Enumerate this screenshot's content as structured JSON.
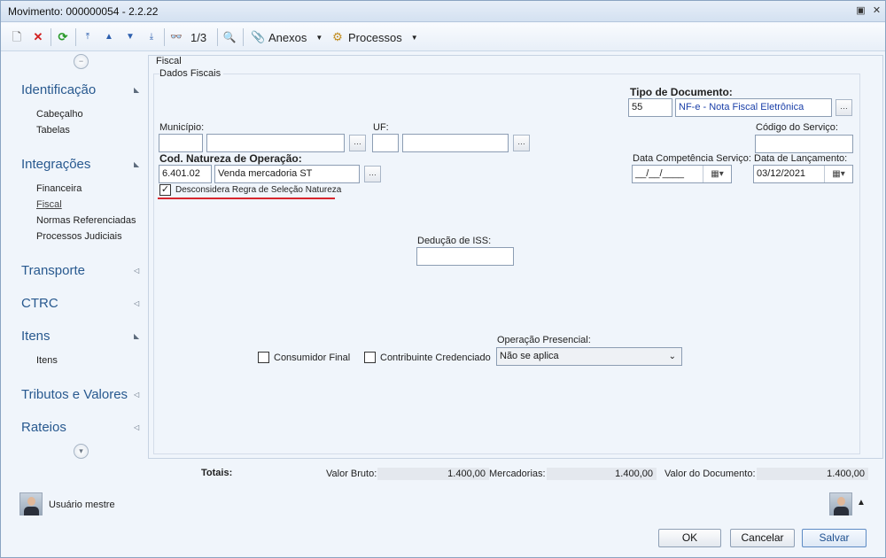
{
  "window": {
    "title": "Movimento: 000000054 - 2.2.22"
  },
  "toolbar": {
    "page_indicator": "1/3",
    "anexos_label": "Anexos",
    "processos_label": "Processos"
  },
  "sidebar": {
    "sections": [
      {
        "label": "Identificação",
        "items": [
          "Cabeçalho",
          "Tabelas"
        ]
      },
      {
        "label": "Integrações",
        "items": [
          "Financeira",
          "Fiscal",
          "Normas Referenciadas",
          "Processos Judiciais"
        ]
      },
      {
        "label": "Transporte",
        "items": []
      },
      {
        "label": "CTRC",
        "items": []
      },
      {
        "label": "Itens",
        "items": [
          "Itens"
        ]
      },
      {
        "label": "Tributos e Valores",
        "items": []
      },
      {
        "label": "Rateios",
        "items": []
      }
    ],
    "active_item": "Fiscal"
  },
  "form": {
    "tab_label": "Fiscal",
    "group_label": "Dados Fiscais",
    "tipo_documento": {
      "label": "Tipo de Documento:",
      "code": "55",
      "description": "NF-e - Nota Fiscal Eletrônica"
    },
    "municipio": {
      "label": "Município:",
      "code": "",
      "name": ""
    },
    "uf": {
      "label": "UF:",
      "code": "",
      "name": ""
    },
    "codigo_servico": {
      "label": "Código do Serviço:",
      "value": ""
    },
    "natureza": {
      "label": "Cod. Natureza de Operação:",
      "code": "6.401.02",
      "description": "Venda mercadoria ST"
    },
    "data_competencia": {
      "label": "Data Competência Serviço:",
      "value": "__/__/____"
    },
    "data_lancamento": {
      "label": "Data de Lançamento:",
      "value": "03/12/2021"
    },
    "desconsidera": {
      "label": "Desconsidera Regra de Seleção Natureza",
      "checked": true
    },
    "deducao_iss": {
      "label": "Dedução de ISS:",
      "value": ""
    },
    "consumidor_final": {
      "label": "Consumidor Final",
      "checked": false
    },
    "contribuinte": {
      "label": "Contribuinte Credenciado",
      "checked": false
    },
    "operacao_presencial": {
      "label": "Operação Presencial:",
      "value": "Não se aplica"
    }
  },
  "totals": {
    "label": "Totais:",
    "valor_bruto_label": "Valor Bruto:",
    "valor_bruto": "1.400,00",
    "mercadorias_label": "Mercadorias:",
    "mercadorias": "1.400,00",
    "valor_documento_label": "Valor do Documento:",
    "valor_documento": "1.400,00"
  },
  "footer": {
    "user": "Usuário mestre",
    "ok": "OK",
    "cancelar": "Cancelar",
    "salvar": "Salvar"
  },
  "colors": {
    "accent": "#28598f",
    "underline": "#d7262e",
    "background": "#f0f5fb"
  }
}
